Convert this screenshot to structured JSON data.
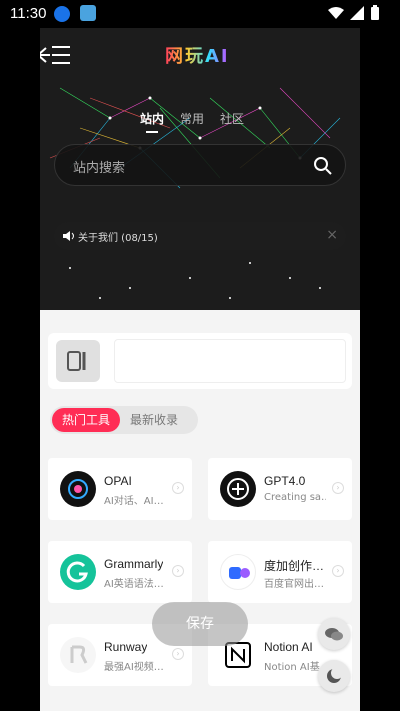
{
  "status_bar": {
    "time": "11:30"
  },
  "header": {
    "logo_text": "网玩AI"
  },
  "tabs": [
    {
      "label": "站内",
      "active": true
    },
    {
      "label": "常用",
      "active": false
    },
    {
      "label": "社区",
      "active": false
    }
  ],
  "search": {
    "placeholder": "站内搜索"
  },
  "notice": {
    "text": "关于我们 (08/15)"
  },
  "filter_pills": [
    {
      "label": "热门工具",
      "active": true
    },
    {
      "label": "最新收录",
      "active": false
    }
  ],
  "tools": [
    {
      "name": "OPAI",
      "desc": "AI对话、AI…",
      "icon": "opai-logo"
    },
    {
      "name": "GPT4.0",
      "desc": "Creating sa…",
      "icon": "openai-logo"
    },
    {
      "name": "Grammarly",
      "desc": "AI英语语法…",
      "icon": "grammarly-logo"
    },
    {
      "name": "度加创作…",
      "desc": "百度官网出…",
      "icon": "dujia-logo"
    },
    {
      "name": "Runway",
      "desc": "最强AI视频…",
      "icon": "runway-logo"
    },
    {
      "name": "Notion AI",
      "desc": "Notion AI基…",
      "icon": "notion-logo"
    }
  ],
  "save_button": {
    "label": "保存"
  },
  "colors": {
    "accent": "#ff2d55",
    "hero_bg": "#1c1c1c",
    "page_bg": "#f4f4f4"
  }
}
